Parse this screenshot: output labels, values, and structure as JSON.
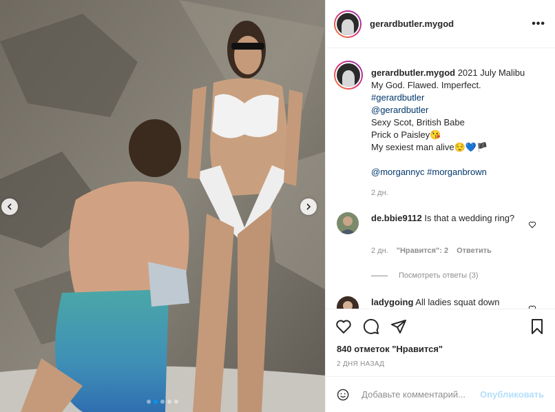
{
  "post": {
    "username": "gerardbutler.mygod",
    "more_icon": "more-horizontal-icon",
    "carousel": {
      "slide_count": 5,
      "active_slide": 1
    }
  },
  "caption": {
    "username": "gerardbutler.mygod",
    "line1": "2021 July Malibu",
    "line2": "My God. Flawed. Imperfect.",
    "hashtag1": "#gerardbutler",
    "mention1": "@gerardbutler",
    "line3": "Sexy Scot, British Babe",
    "line4": "Prick o Paisley😘",
    "line5": "My sexiest man alive😌💙🏴",
    "mention2": "@morgannyc",
    "hashtag2": "#morganbrown",
    "time": "2 дн."
  },
  "comments": [
    {
      "username": "de.bbie9112",
      "text": "Is that a wedding ring?",
      "time": "2 дн.",
      "likes": "\"Нравится\": 2",
      "reply": "Ответить",
      "view_replies": "Посмотреть ответы (3)"
    },
    {
      "username": "ladygoing",
      "text": "All ladies squat down"
    }
  ],
  "actions": {
    "like_icon": "heart-icon",
    "comment_icon": "comment-icon",
    "share_icon": "share-icon",
    "save_icon": "bookmark-icon",
    "likes_text": "840 отметок \"Нравится\"",
    "date_text": "2 ДНЯ НАЗАД"
  },
  "add_comment": {
    "emoji_icon": "emoji-icon",
    "placeholder": "Добавьте комментарий...",
    "publish_label": "Опубликовать"
  },
  "colors": {
    "link": "#00376b",
    "accent": "#0095f6",
    "publish_disabled": "#b2dffc"
  }
}
